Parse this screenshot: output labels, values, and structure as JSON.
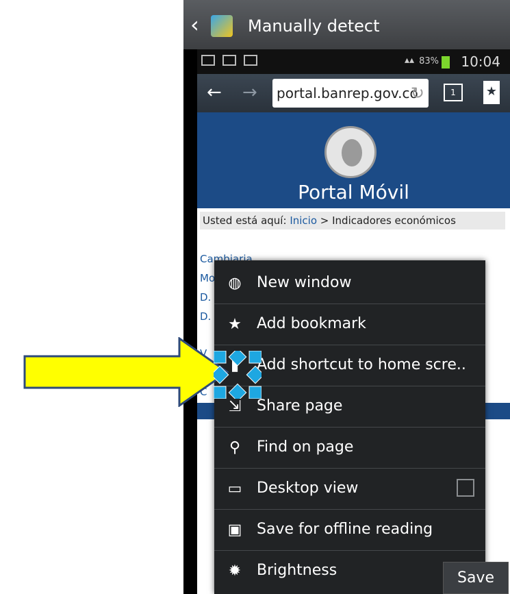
{
  "window": {
    "title": "Manually detect",
    "back_icon": "chevron-left-icon"
  },
  "status_bar": {
    "battery": "83%",
    "time": "10:04",
    "accent": "#7cd52d"
  },
  "browser": {
    "url": "portal.banrep.gov.co",
    "back_icon": "arrow-left-icon",
    "forward_icon": "arrow-right-icon",
    "tab_count": "1",
    "bookmark_icon": "bookmark-star-icon"
  },
  "page": {
    "title": "Portal Móvil",
    "breadcrumb_prefix": "Usted está aquí:",
    "breadcrumb_link": "Inicio",
    "breadcrumb_rest": " > Indicadores económicos",
    "links": [
      "Cambiaria",
      "Mo",
      "D.",
      "D."
    ],
    "links2": [
      "V",
      "C"
    ],
    "brand_color": "#1c4b86"
  },
  "menu": {
    "items": [
      {
        "label": "New window",
        "icon": "globe-plus-icon"
      },
      {
        "label": "Add bookmark",
        "icon": "bookmark-star-icon"
      },
      {
        "label": "Add shortcut to home scre..",
        "icon": "bookmark-icon"
      },
      {
        "label": "Share page",
        "icon": "share-icon"
      },
      {
        "label": "Find on page",
        "icon": "search-icon"
      },
      {
        "label": "Desktop view",
        "icon": "monitor-icon"
      },
      {
        "label": "Save for offline reading",
        "icon": "save-icon"
      },
      {
        "label": "Brightness",
        "icon": "brightness-icon"
      }
    ],
    "save_label": "Save"
  },
  "annotation": {
    "arrow_color": "#ffff00",
    "marker_color": "#1ea7e1"
  }
}
